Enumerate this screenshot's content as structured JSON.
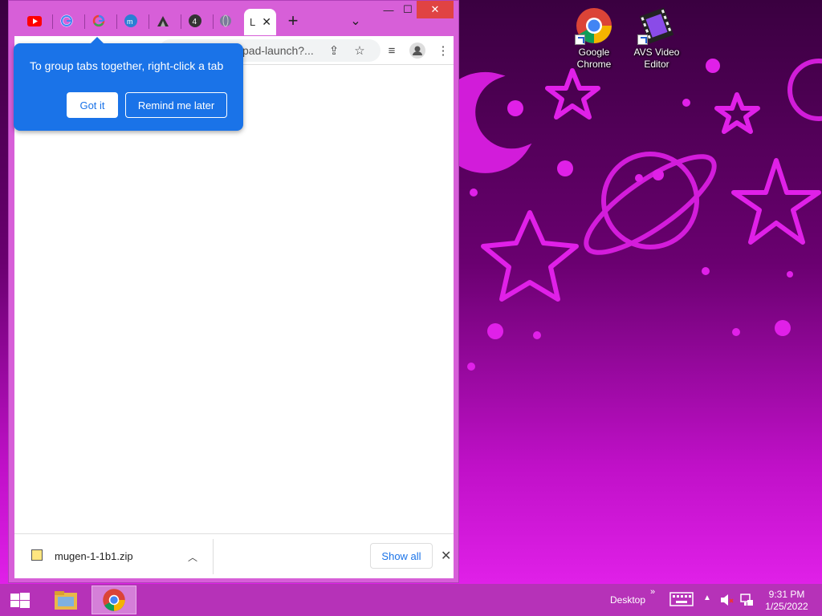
{
  "desktop": {
    "icons": [
      {
        "label": "Google Chrome",
        "icon": "chrome-icon"
      },
      {
        "label": "AVS Video Editor",
        "icon": "avs-video-editor-icon"
      }
    ]
  },
  "browser": {
    "tabs": [
      {
        "icon": "youtube-icon"
      },
      {
        "icon": "google-icon"
      },
      {
        "icon": "google-icon"
      },
      {
        "icon": "site-icon"
      },
      {
        "icon": "site-icon"
      },
      {
        "icon": "site-icon"
      },
      {
        "icon": "globe-icon"
      },
      {
        "icon": "page-icon",
        "label": "L",
        "active": true
      }
    ],
    "new_tab": "+",
    "url_fragment": "pad-launch?...",
    "window_controls": {
      "minimize": "—",
      "maximize": "☐",
      "close": "✕"
    },
    "callout": {
      "text": "To group tabs together, right-click a tab",
      "got_it": "Got it",
      "remind_later": "Remind me later"
    },
    "download_bar": {
      "file_name": "mugen-1-1b1.zip",
      "show_all": "Show all"
    }
  },
  "taskbar": {
    "desktop_label": "Desktop",
    "time": "9:31 PM",
    "date": "1/25/2022"
  },
  "colors": {
    "accent": "#1a73e8",
    "window_frame": "#d75fd8",
    "taskbar": "#b632b8"
  }
}
